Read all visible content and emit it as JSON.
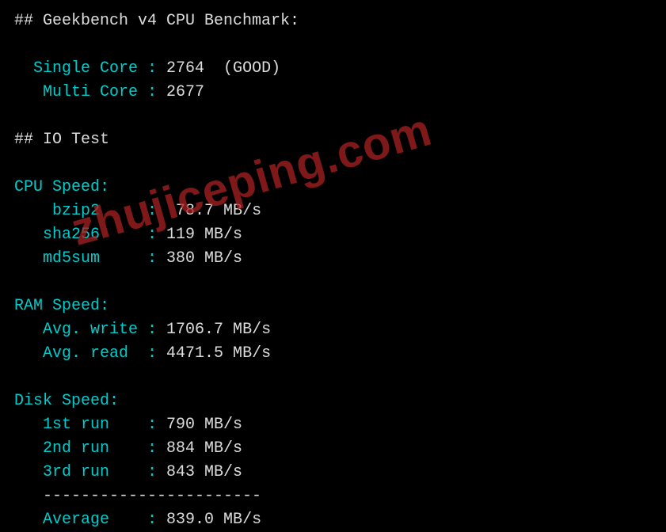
{
  "geekbench": {
    "header": "## Geekbench v4 CPU Benchmark:",
    "single_label": "Single Core : ",
    "single_value": "2764  (GOOD)",
    "multi_label": "Multi Core : ",
    "multi_value": "2677"
  },
  "io_test": {
    "header": "## IO Test"
  },
  "cpu_speed": {
    "header": "CPU Speed:",
    "bzip2_label": "bzip2     : ",
    "bzip2_value": " 78.7 MB/s",
    "sha256_label": "sha256     : ",
    "sha256_value": "119 MB/s",
    "md5sum_label": "md5sum     : ",
    "md5sum_value": "380 MB/s"
  },
  "ram_speed": {
    "header": "RAM Speed:",
    "write_label": "Avg. write : ",
    "write_value": "1706.7 MB/s",
    "read_label": "Avg. read  : ",
    "read_value": "4471.5 MB/s"
  },
  "disk_speed": {
    "header": "Disk Speed:",
    "run1_label": "1st run    : ",
    "run1_value": "790 MB/s",
    "run2_label": "2nd run    : ",
    "run2_value": "884 MB/s",
    "run3_label": "3rd run    : ",
    "run3_value": "843 MB/s",
    "divider": "-----------------------",
    "avg_label": "Average    : ",
    "avg_value": "839.0 MB/s"
  },
  "watermark": "zhujiceping.com"
}
